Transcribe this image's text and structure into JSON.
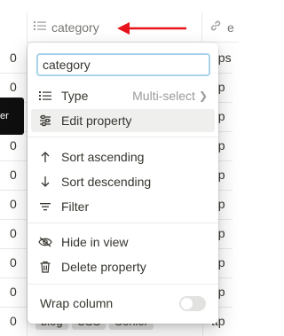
{
  "table": {
    "category_header": "category",
    "next_header": "e",
    "row_value": "0",
    "url_fragment": "ttp",
    "url_fragment_alt": "ttps",
    "tooltip_fragment": "er",
    "bottom_tags": [
      "blog",
      "CSS",
      "Senior"
    ]
  },
  "menu": {
    "name_input_value": "category",
    "type_label": "Type",
    "type_value": "Multi-select",
    "edit_property_label": "Edit property",
    "sort_ascending_label": "Sort ascending",
    "sort_descending_label": "Sort descending",
    "filter_label": "Filter",
    "hide_in_view_label": "Hide in view",
    "delete_property_label": "Delete property",
    "wrap_column_label": "Wrap column",
    "wrap_column_enabled": false
  },
  "colors": {
    "annotation_arrow": "#e8141b",
    "input_focus_border": "#a8d2ec",
    "hover_background": "#efefee"
  },
  "icons": {
    "category_header": "list-icon",
    "type": "list-icon",
    "edit_property": "sliders-icon",
    "sort_ascending": "arrow-up-icon",
    "sort_descending": "arrow-down-icon",
    "filter": "filter-icon",
    "hide_in_view": "eye-slash-icon",
    "delete_property": "trash-icon"
  }
}
